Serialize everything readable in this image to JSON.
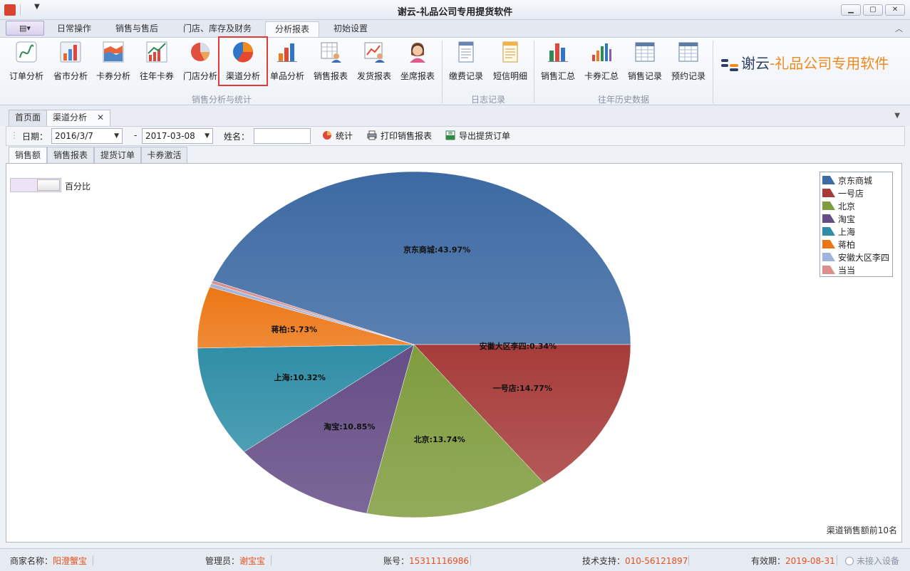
{
  "window": {
    "title": "谢云-礼品公司专用提货软件",
    "controls": [
      "minimize-icon",
      "maximize-icon",
      "close-icon"
    ]
  },
  "ribbon_tabs": [
    "日常操作",
    "销售与售后",
    "门店、库存及财务",
    "分析报表",
    "初始设置"
  ],
  "active_tab": "分析报表",
  "ribbon_groups": [
    {
      "label": "销售分析与统计",
      "buttons": [
        {
          "label": "订单分析",
          "icon": "line-chart-icon"
        },
        {
          "label": "省市分析",
          "icon": "bar-chart-icon"
        },
        {
          "label": "卡券分析",
          "icon": "area-chart-icon"
        },
        {
          "label": "往年卡券",
          "icon": "trend-chart-icon"
        },
        {
          "label": "门店分析",
          "icon": "pie-chart-icon"
        },
        {
          "label": "渠道分析",
          "icon": "donut-chart-icon"
        },
        {
          "label": "单品分析",
          "icon": "column-chart-icon"
        },
        {
          "label": "销售报表",
          "icon": "report-user-icon"
        },
        {
          "label": "发货报表",
          "icon": "shipping-chart-icon"
        },
        {
          "label": "坐席报表",
          "icon": "agent-headset-icon"
        }
      ]
    },
    {
      "label": "日志记录",
      "buttons": [
        {
          "label": "缴费记录",
          "icon": "fee-document-icon"
        },
        {
          "label": "短信明细",
          "icon": "sms-document-icon"
        }
      ]
    },
    {
      "label": "往年历史数据",
      "buttons": [
        {
          "label": "销售汇总",
          "icon": "sales-summary-icon"
        },
        {
          "label": "卡券汇总",
          "icon": "card-summary-icon"
        },
        {
          "label": "销售记录",
          "icon": "sales-record-icon"
        },
        {
          "label": "预约记录",
          "icon": "booking-record-icon"
        }
      ]
    }
  ],
  "brand": {
    "part1": "谢云",
    "part2": "-礼品公司专用软件"
  },
  "doc_tabs": [
    "首页面",
    "渠道分析"
  ],
  "toolbar": {
    "date_label": "日期：",
    "date_from": "2016/3/7",
    "date_sep": "-",
    "date_to": "2017-03-08",
    "name_label": "姓名：",
    "name_value": "",
    "stat_btn": "统计",
    "print_btn": "打印销售报表",
    "export_btn": "导出提货订单"
  },
  "sub_tabs": [
    "销售额",
    "销售报表",
    "提货订单",
    "卡券激活"
  ],
  "percent_toggle_label": "百分比",
  "chart_footer": "渠道销售额前10名",
  "chart_data": {
    "type": "pie",
    "title": "",
    "series": [
      {
        "name": "京东商城",
        "value": 43.97,
        "label": "京东商城:43.97%",
        "color": "#3d6aa3"
      },
      {
        "name": "一号店",
        "value": 14.77,
        "label": "一号店:14.77%",
        "color": "#a63c3a"
      },
      {
        "name": "北京",
        "value": 13.74,
        "label": "北京:13.74%",
        "color": "#7f9c3e"
      },
      {
        "name": "淘宝",
        "value": 10.85,
        "label": "淘宝:10.85%",
        "color": "#654d86"
      },
      {
        "name": "上海",
        "value": 10.32,
        "label": "上海:10.32%",
        "color": "#2f8ea6"
      },
      {
        "name": "蒋柏",
        "value": 5.73,
        "label": "蒋柏:5.73%",
        "color": "#ec7614"
      },
      {
        "name": "安徽大区李四",
        "value": 0.34,
        "label": "安徽大区李四:0.34%",
        "color": "#9fb4dc"
      },
      {
        "name": "当当",
        "value": 0.28,
        "label": "",
        "color": "#dc8f8d"
      }
    ],
    "legend_position": "top-right"
  },
  "statusbar": {
    "merchant_label": "商家名称：",
    "merchant": "阳澄蟹宝",
    "admin_label": "管理员：",
    "admin": "谢宝宝",
    "account_label": "账号：",
    "account": "15311116986",
    "support_label": "技术支持：",
    "support": "010-56121897",
    "expiry_label": "有效期：",
    "expiry": "2019-08-31",
    "device": "未接入设备"
  }
}
